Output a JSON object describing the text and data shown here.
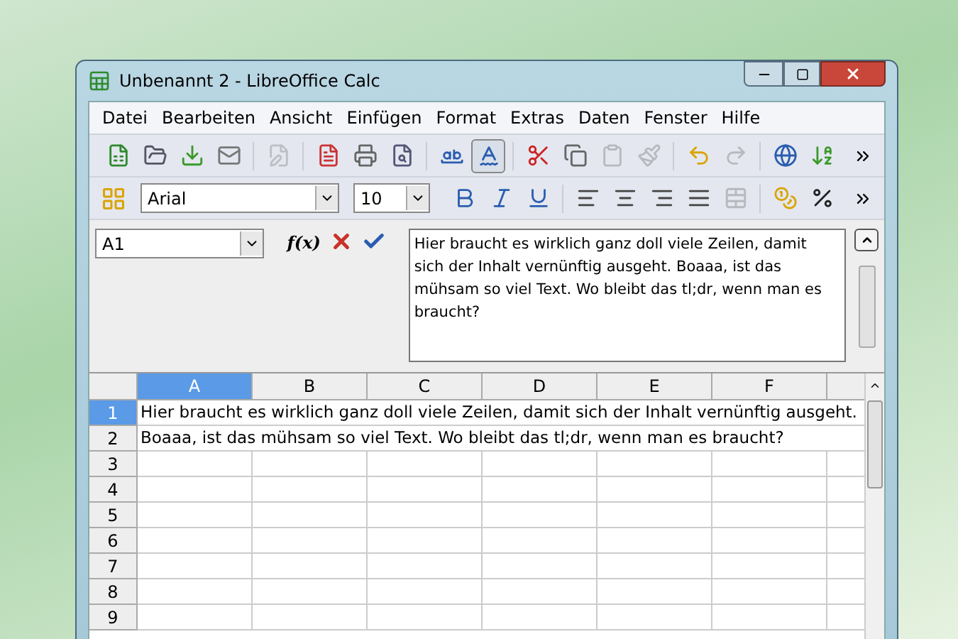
{
  "window": {
    "title": "Unbenannt 2 - LibreOffice Calc"
  },
  "menu": [
    "Datei",
    "Bearbeiten",
    "Ansicht",
    "Einfügen",
    "Format",
    "Extras",
    "Daten",
    "Fenster",
    "Hilfe"
  ],
  "toolbar_standard": [
    {
      "kind": "new",
      "disabled": false,
      "selected": false
    },
    {
      "kind": "open",
      "disabled": false,
      "selected": false
    },
    {
      "kind": "save",
      "disabled": false,
      "selected": false
    },
    {
      "kind": "mail",
      "disabled": false,
      "selected": false
    },
    {
      "kind": "edit",
      "disabled": true,
      "selected": false
    },
    {
      "kind": "pdf",
      "disabled": false,
      "selected": false
    },
    {
      "kind": "print",
      "disabled": false,
      "selected": false
    },
    {
      "kind": "preview",
      "disabled": false,
      "selected": false
    },
    {
      "kind": "spellcheck",
      "disabled": false,
      "selected": false
    },
    {
      "kind": "autospell",
      "disabled": false,
      "selected": true
    },
    {
      "kind": "cut",
      "disabled": false,
      "selected": false
    },
    {
      "kind": "copy",
      "disabled": false,
      "selected": false
    },
    {
      "kind": "paste",
      "disabled": true,
      "selected": false
    },
    {
      "kind": "clone",
      "disabled": true,
      "selected": false
    },
    {
      "kind": "undo",
      "disabled": false,
      "selected": false
    },
    {
      "kind": "redo",
      "disabled": true,
      "selected": false
    },
    {
      "kind": "navigator",
      "disabled": false,
      "selected": false
    },
    {
      "kind": "sort",
      "disabled": false,
      "selected": false
    }
  ],
  "toolbar_format": {
    "font": "Arial",
    "size": "10",
    "buttons": [
      {
        "kind": "bold",
        "disabled": false
      },
      {
        "kind": "italic",
        "disabled": false
      },
      {
        "kind": "underline",
        "disabled": false
      },
      {
        "kind": "align-left",
        "disabled": false
      },
      {
        "kind": "align-center",
        "disabled": false
      },
      {
        "kind": "align-right",
        "disabled": false
      },
      {
        "kind": "justify",
        "disabled": false
      },
      {
        "kind": "merge",
        "disabled": true
      },
      {
        "kind": "currency",
        "disabled": false
      },
      {
        "kind": "percent",
        "disabled": false
      }
    ]
  },
  "formula_bar": {
    "name_box": "A1",
    "function_label": "f(x)",
    "content": "Hier braucht es wirklich ganz doll viele Zeilen, damit sich der Inhalt vernünftig ausgeht. Boaaa, ist das mühsam so viel Text. Wo bleibt das tl;dr, wenn man es braucht?"
  },
  "sheet": {
    "columns": [
      {
        "label": "A",
        "selected": true
      },
      {
        "label": "B",
        "selected": false
      },
      {
        "label": "C",
        "selected": false
      },
      {
        "label": "D",
        "selected": false
      },
      {
        "label": "E",
        "selected": false
      },
      {
        "label": "F",
        "selected": false
      }
    ],
    "rows": [
      {
        "label": "1",
        "selected": true,
        "text": "Hier braucht es wirklich ganz doll viele Zeilen, damit sich der Inhalt vernünftig ausgeht."
      },
      {
        "label": "2",
        "selected": false,
        "text": "Boaaa, ist das mühsam so viel Text. Wo bleibt das tl;dr, wenn man es braucht?"
      },
      {
        "label": "3",
        "selected": false
      },
      {
        "label": "4",
        "selected": false
      },
      {
        "label": "5",
        "selected": false
      },
      {
        "label": "6",
        "selected": false
      },
      {
        "label": "7",
        "selected": false
      },
      {
        "label": "8",
        "selected": false
      },
      {
        "label": "9",
        "selected": false
      }
    ]
  }
}
